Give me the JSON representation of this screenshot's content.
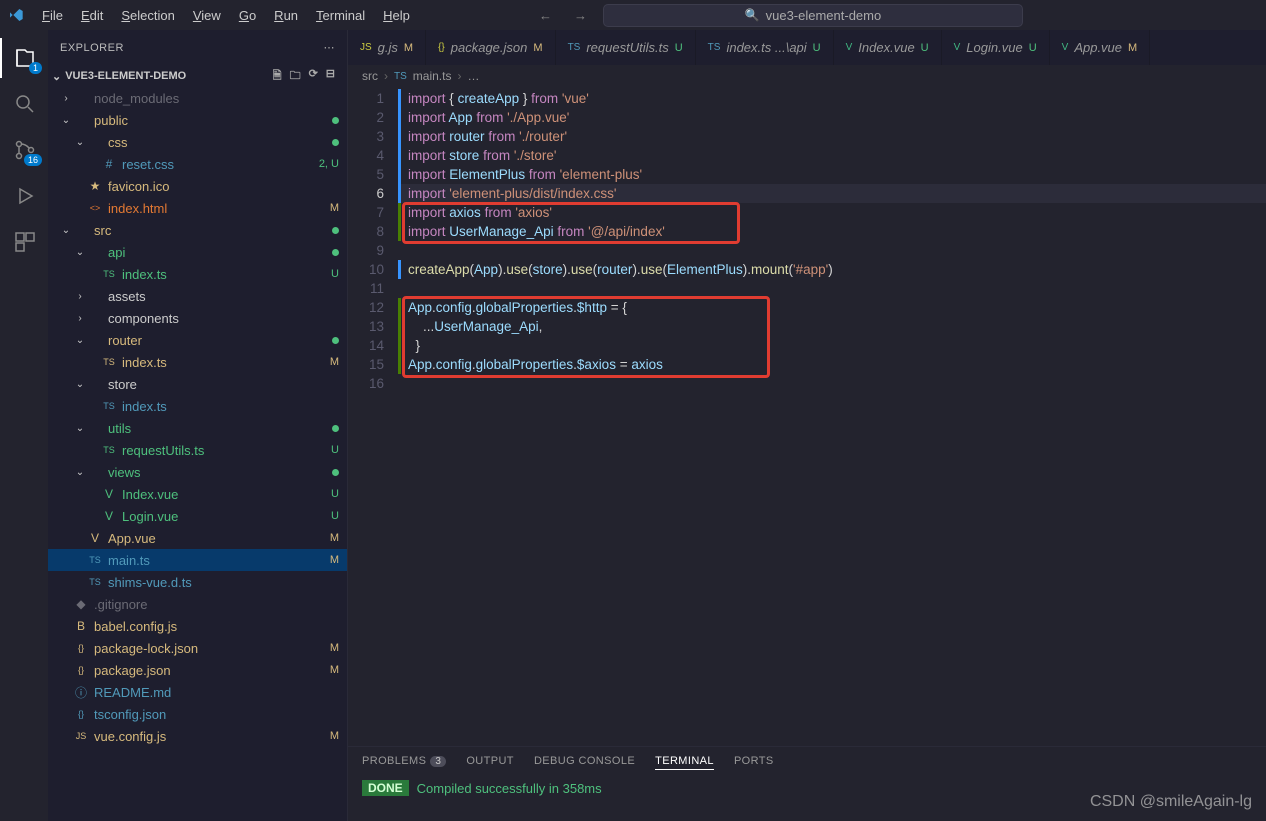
{
  "menu": [
    "File",
    "Edit",
    "Selection",
    "View",
    "Go",
    "Run",
    "Terminal",
    "Help"
  ],
  "title": "vue3-element-demo",
  "sidebar": {
    "title": "EXPLORER",
    "section": "VUE3-ELEMENT-DEMO"
  },
  "tree": [
    {
      "d": 0,
      "ch": "›",
      "ic": "",
      "cls": "clr-dim",
      "label": "node_modules",
      "st": ""
    },
    {
      "d": 0,
      "ch": "⌄",
      "ic": "",
      "cls": "clr-gold",
      "label": "public",
      "st": "dot"
    },
    {
      "d": 1,
      "ch": "⌄",
      "ic": "",
      "cls": "clr-gold",
      "label": "css",
      "st": "dot"
    },
    {
      "d": 2,
      "ch": "",
      "ic": "#",
      "cls": "clr-blue",
      "label": "reset.css",
      "st": "2, U",
      "scls": "clr-green"
    },
    {
      "d": 1,
      "ch": "",
      "ic": "★",
      "cls": "clr-gold",
      "label": "favicon.ico",
      "st": ""
    },
    {
      "d": 1,
      "ch": "",
      "ic": "<>",
      "cls": "clr-orange",
      "label": "index.html",
      "st": "M",
      "scls": "clr-gold"
    },
    {
      "d": 0,
      "ch": "⌄",
      "ic": "",
      "cls": "clr-gold",
      "label": "src",
      "st": "dot"
    },
    {
      "d": 1,
      "ch": "⌄",
      "ic": "",
      "cls": "clr-green",
      "label": "api",
      "st": "dot"
    },
    {
      "d": 2,
      "ch": "",
      "ic": "TS",
      "cls": "clr-green",
      "label": "index.ts",
      "st": "U",
      "scls": "clr-green"
    },
    {
      "d": 1,
      "ch": "›",
      "ic": "",
      "cls": "",
      "label": "assets",
      "st": ""
    },
    {
      "d": 1,
      "ch": "›",
      "ic": "",
      "cls": "",
      "label": "components",
      "st": ""
    },
    {
      "d": 1,
      "ch": "⌄",
      "ic": "",
      "cls": "clr-gold",
      "label": "router",
      "st": "dot"
    },
    {
      "d": 2,
      "ch": "",
      "ic": "TS",
      "cls": "clr-gold",
      "label": "index.ts",
      "st": "M",
      "scls": "clr-gold"
    },
    {
      "d": 1,
      "ch": "⌄",
      "ic": "",
      "cls": "",
      "label": "store",
      "st": ""
    },
    {
      "d": 2,
      "ch": "",
      "ic": "TS",
      "cls": "clr-blue",
      "label": "index.ts",
      "st": ""
    },
    {
      "d": 1,
      "ch": "⌄",
      "ic": "",
      "cls": "clr-green",
      "label": "utils",
      "st": "dot"
    },
    {
      "d": 2,
      "ch": "",
      "ic": "TS",
      "cls": "clr-green",
      "label": "requestUtils.ts",
      "st": "U",
      "scls": "clr-green"
    },
    {
      "d": 1,
      "ch": "⌄",
      "ic": "",
      "cls": "clr-green",
      "label": "views",
      "st": "dot"
    },
    {
      "d": 2,
      "ch": "",
      "ic": "V",
      "cls": "clr-green",
      "label": "Index.vue",
      "st": "U",
      "scls": "clr-green"
    },
    {
      "d": 2,
      "ch": "",
      "ic": "V",
      "cls": "clr-green",
      "label": "Login.vue",
      "st": "U",
      "scls": "clr-green"
    },
    {
      "d": 1,
      "ch": "",
      "ic": "V",
      "cls": "clr-gold",
      "label": "App.vue",
      "st": "M",
      "scls": "clr-gold"
    },
    {
      "d": 1,
      "ch": "",
      "ic": "TS",
      "cls": "clr-blue",
      "label": "main.ts",
      "st": "M",
      "scls": "clr-gold",
      "sel": true
    },
    {
      "d": 1,
      "ch": "",
      "ic": "TS",
      "cls": "clr-blue",
      "label": "shims-vue.d.ts",
      "st": ""
    },
    {
      "d": 0,
      "ch": "",
      "ic": "◆",
      "cls": "clr-dim",
      "label": ".gitignore",
      "st": ""
    },
    {
      "d": 0,
      "ch": "",
      "ic": "B",
      "cls": "clr-gold",
      "label": "babel.config.js",
      "st": ""
    },
    {
      "d": 0,
      "ch": "",
      "ic": "{}",
      "cls": "clr-gold",
      "label": "package-lock.json",
      "st": "M",
      "scls": "clr-gold"
    },
    {
      "d": 0,
      "ch": "",
      "ic": "{}",
      "cls": "clr-gold",
      "label": "package.json",
      "st": "M",
      "scls": "clr-gold"
    },
    {
      "d": 0,
      "ch": "",
      "ic": "ⓘ",
      "cls": "clr-md",
      "label": "README.md",
      "st": ""
    },
    {
      "d": 0,
      "ch": "",
      "ic": "{}",
      "cls": "clr-blue",
      "label": "tsconfig.json",
      "st": ""
    },
    {
      "d": 0,
      "ch": "",
      "ic": "JS",
      "cls": "clr-gold",
      "label": "vue.config.js",
      "st": "M",
      "scls": "clr-gold"
    }
  ],
  "tabs": [
    {
      "ic": "JS",
      "cls": "clr-yellow",
      "label": "g.js",
      "suf": "M",
      "sufcls": "clr-gold"
    },
    {
      "ic": "{}",
      "cls": "clr-yellow",
      "label": "package.json",
      "suf": "M",
      "sufcls": "clr-gold"
    },
    {
      "ic": "TS",
      "cls": "clr-blue",
      "label": "requestUtils.ts",
      "suf": "U",
      "sufcls": "clr-green"
    },
    {
      "ic": "TS",
      "cls": "clr-blue",
      "label": "index.ts ...\\api",
      "suf": "U",
      "sufcls": "clr-green"
    },
    {
      "ic": "V",
      "cls": "clr-vue",
      "label": "Index.vue",
      "suf": "U",
      "sufcls": "clr-green"
    },
    {
      "ic": "V",
      "cls": "clr-vue",
      "label": "Login.vue",
      "suf": "U",
      "sufcls": "clr-green"
    },
    {
      "ic": "V",
      "cls": "clr-vue",
      "label": "App.vue",
      "suf": "M",
      "sufcls": "clr-gold"
    }
  ],
  "breadcrumb": [
    "src",
    "main.ts",
    "…"
  ],
  "breadcrumb_icon": "TS",
  "code_lines": 16,
  "panel": {
    "tabs": [
      "PROBLEMS",
      "OUTPUT",
      "DEBUG CONSOLE",
      "TERMINAL",
      "PORTS"
    ],
    "active": "TERMINAL",
    "problems_count": "3",
    "done": "DONE",
    "msg": "Compiled successfully in 358ms"
  },
  "watermark": "CSDN @smileAgain-lg",
  "activity_badges": {
    "files": "1",
    "scm": "16"
  }
}
